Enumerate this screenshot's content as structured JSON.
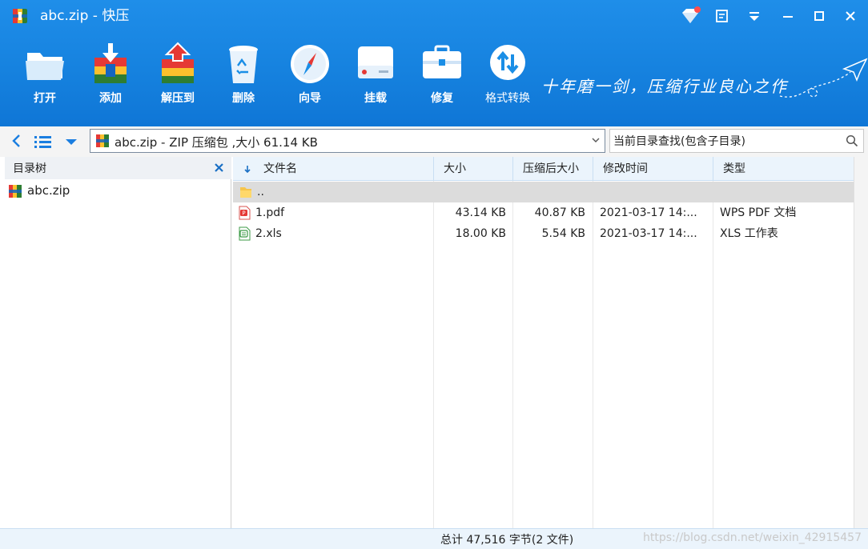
{
  "window": {
    "title": "abc.zip - 快压"
  },
  "toolbar": {
    "buttons": [
      {
        "id": "open",
        "label": "打开",
        "icon": "folder-open-icon"
      },
      {
        "id": "add",
        "label": "添加",
        "icon": "add-archive-icon"
      },
      {
        "id": "extract",
        "label": "解压到",
        "icon": "extract-archive-icon"
      },
      {
        "id": "delete",
        "label": "删除",
        "icon": "recycle-bin-icon"
      },
      {
        "id": "wizard",
        "label": "向导",
        "icon": "compass-icon"
      },
      {
        "id": "mount",
        "label": "挂载",
        "icon": "drive-icon"
      },
      {
        "id": "repair",
        "label": "修复",
        "icon": "toolbox-icon"
      },
      {
        "id": "convert",
        "label": "格式转换",
        "icon": "convert-arrows-icon"
      }
    ],
    "slogan": "十年磨一剑，压缩行业良心之作"
  },
  "address": {
    "path_text": "abc.zip - ZIP 压缩包 ,大小 61.14 KB"
  },
  "search": {
    "value": "当前目录查找(包含子目录)"
  },
  "tree": {
    "title": "目录树",
    "items": [
      {
        "label": "abc.zip"
      }
    ]
  },
  "filelist": {
    "columns": [
      "文件名",
      "大小",
      "压缩后大小",
      "修改时间",
      "类型"
    ],
    "rows": [
      {
        "name": "..",
        "size": "",
        "packed": "",
        "modified": "",
        "type": "",
        "icon": "folder-icon"
      },
      {
        "name": "1.pdf",
        "size": "43.14 KB",
        "packed": "40.87 KB",
        "modified": "2021-03-17   14:...",
        "type": "WPS PDF 文档",
        "icon": "pdf-file-icon"
      },
      {
        "name": "2.xls",
        "size": "18.00 KB",
        "packed": "5.54 KB",
        "modified": "2021-03-17   14:...",
        "type": "XLS 工作表",
        "icon": "xls-file-icon"
      }
    ]
  },
  "status": {
    "summary": "总计  47,516 字节(2 文件)",
    "watermark": "https://blog.csdn.net/weixin_42915457"
  },
  "colors": {
    "header": "#1682df",
    "selected_row": "#dcdcdc",
    "column_header": "#ebf4fc"
  }
}
